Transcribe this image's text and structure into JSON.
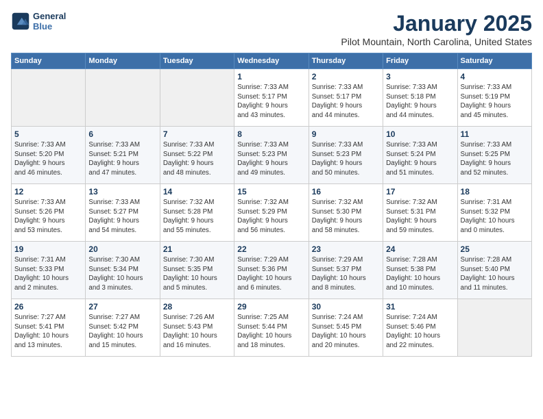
{
  "logo": {
    "line1": "General",
    "line2": "Blue"
  },
  "title": "January 2025",
  "location": "Pilot Mountain, North Carolina, United States",
  "weekdays": [
    "Sunday",
    "Monday",
    "Tuesday",
    "Wednesday",
    "Thursday",
    "Friday",
    "Saturday"
  ],
  "weeks": [
    [
      {
        "day": "",
        "info": ""
      },
      {
        "day": "",
        "info": ""
      },
      {
        "day": "",
        "info": ""
      },
      {
        "day": "1",
        "info": "Sunrise: 7:33 AM\nSunset: 5:17 PM\nDaylight: 9 hours\nand 43 minutes."
      },
      {
        "day": "2",
        "info": "Sunrise: 7:33 AM\nSunset: 5:17 PM\nDaylight: 9 hours\nand 44 minutes."
      },
      {
        "day": "3",
        "info": "Sunrise: 7:33 AM\nSunset: 5:18 PM\nDaylight: 9 hours\nand 44 minutes."
      },
      {
        "day": "4",
        "info": "Sunrise: 7:33 AM\nSunset: 5:19 PM\nDaylight: 9 hours\nand 45 minutes."
      }
    ],
    [
      {
        "day": "5",
        "info": "Sunrise: 7:33 AM\nSunset: 5:20 PM\nDaylight: 9 hours\nand 46 minutes."
      },
      {
        "day": "6",
        "info": "Sunrise: 7:33 AM\nSunset: 5:21 PM\nDaylight: 9 hours\nand 47 minutes."
      },
      {
        "day": "7",
        "info": "Sunrise: 7:33 AM\nSunset: 5:22 PM\nDaylight: 9 hours\nand 48 minutes."
      },
      {
        "day": "8",
        "info": "Sunrise: 7:33 AM\nSunset: 5:23 PM\nDaylight: 9 hours\nand 49 minutes."
      },
      {
        "day": "9",
        "info": "Sunrise: 7:33 AM\nSunset: 5:23 PM\nDaylight: 9 hours\nand 50 minutes."
      },
      {
        "day": "10",
        "info": "Sunrise: 7:33 AM\nSunset: 5:24 PM\nDaylight: 9 hours\nand 51 minutes."
      },
      {
        "day": "11",
        "info": "Sunrise: 7:33 AM\nSunset: 5:25 PM\nDaylight: 9 hours\nand 52 minutes."
      }
    ],
    [
      {
        "day": "12",
        "info": "Sunrise: 7:33 AM\nSunset: 5:26 PM\nDaylight: 9 hours\nand 53 minutes."
      },
      {
        "day": "13",
        "info": "Sunrise: 7:33 AM\nSunset: 5:27 PM\nDaylight: 9 hours\nand 54 minutes."
      },
      {
        "day": "14",
        "info": "Sunrise: 7:32 AM\nSunset: 5:28 PM\nDaylight: 9 hours\nand 55 minutes."
      },
      {
        "day": "15",
        "info": "Sunrise: 7:32 AM\nSunset: 5:29 PM\nDaylight: 9 hours\nand 56 minutes."
      },
      {
        "day": "16",
        "info": "Sunrise: 7:32 AM\nSunset: 5:30 PM\nDaylight: 9 hours\nand 58 minutes."
      },
      {
        "day": "17",
        "info": "Sunrise: 7:32 AM\nSunset: 5:31 PM\nDaylight: 9 hours\nand 59 minutes."
      },
      {
        "day": "18",
        "info": "Sunrise: 7:31 AM\nSunset: 5:32 PM\nDaylight: 10 hours\nand 0 minutes."
      }
    ],
    [
      {
        "day": "19",
        "info": "Sunrise: 7:31 AM\nSunset: 5:33 PM\nDaylight: 10 hours\nand 2 minutes."
      },
      {
        "day": "20",
        "info": "Sunrise: 7:30 AM\nSunset: 5:34 PM\nDaylight: 10 hours\nand 3 minutes."
      },
      {
        "day": "21",
        "info": "Sunrise: 7:30 AM\nSunset: 5:35 PM\nDaylight: 10 hours\nand 5 minutes."
      },
      {
        "day": "22",
        "info": "Sunrise: 7:29 AM\nSunset: 5:36 PM\nDaylight: 10 hours\nand 6 minutes."
      },
      {
        "day": "23",
        "info": "Sunrise: 7:29 AM\nSunset: 5:37 PM\nDaylight: 10 hours\nand 8 minutes."
      },
      {
        "day": "24",
        "info": "Sunrise: 7:28 AM\nSunset: 5:38 PM\nDaylight: 10 hours\nand 10 minutes."
      },
      {
        "day": "25",
        "info": "Sunrise: 7:28 AM\nSunset: 5:40 PM\nDaylight: 10 hours\nand 11 minutes."
      }
    ],
    [
      {
        "day": "26",
        "info": "Sunrise: 7:27 AM\nSunset: 5:41 PM\nDaylight: 10 hours\nand 13 minutes."
      },
      {
        "day": "27",
        "info": "Sunrise: 7:27 AM\nSunset: 5:42 PM\nDaylight: 10 hours\nand 15 minutes."
      },
      {
        "day": "28",
        "info": "Sunrise: 7:26 AM\nSunset: 5:43 PM\nDaylight: 10 hours\nand 16 minutes."
      },
      {
        "day": "29",
        "info": "Sunrise: 7:25 AM\nSunset: 5:44 PM\nDaylight: 10 hours\nand 18 minutes."
      },
      {
        "day": "30",
        "info": "Sunrise: 7:24 AM\nSunset: 5:45 PM\nDaylight: 10 hours\nand 20 minutes."
      },
      {
        "day": "31",
        "info": "Sunrise: 7:24 AM\nSunset: 5:46 PM\nDaylight: 10 hours\nand 22 minutes."
      },
      {
        "day": "",
        "info": ""
      }
    ]
  ]
}
